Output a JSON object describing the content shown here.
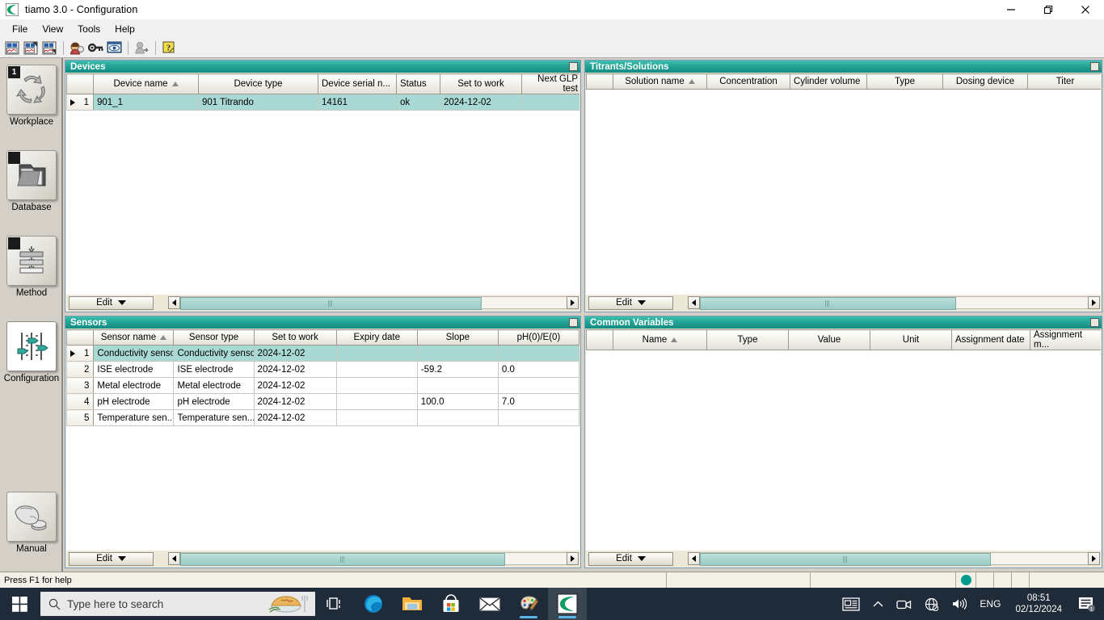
{
  "window": {
    "title": "tiamo 3.0 - Configuration",
    "app_icon": "tiamo-logo-icon",
    "controls": {
      "minimize": "—",
      "maximize": "❐",
      "close": "✕"
    }
  },
  "menubar": {
    "items": [
      "File",
      "View",
      "Tools",
      "Help"
    ]
  },
  "toolbar": {
    "buttons": [
      {
        "name": "new-configuration-icon"
      },
      {
        "name": "save-configuration-icon"
      },
      {
        "name": "save-as-configuration-icon"
      },
      {
        "name": "user-administration-icon"
      },
      {
        "name": "change-password-icon"
      },
      {
        "name": "login-icon"
      },
      {
        "name": "user-logout-icon"
      },
      {
        "name": "help-icon"
      }
    ]
  },
  "sidebar": {
    "items": [
      {
        "label": "Workplace",
        "badge": "1",
        "icon": "recycle-arrows-icon",
        "selected": false
      },
      {
        "label": "Database",
        "badge": "",
        "icon": "folder-icon",
        "selected": false
      },
      {
        "label": "Method",
        "badge": "",
        "icon": "method-stack-icon",
        "selected": false
      },
      {
        "label": "Configuration",
        "badge": "",
        "icon": "sliders-icon",
        "selected": true
      },
      {
        "label": "Manual",
        "badge": "",
        "icon": "hand-press-button-icon",
        "selected": false
      }
    ]
  },
  "panels": {
    "devices": {
      "title": "Devices",
      "columns": [
        "",
        "Device name",
        "Device type",
        "Device serial n...",
        "Status",
        "Set to work",
        "Next GLP test"
      ],
      "sorted_column": "Device name",
      "rows": [
        {
          "num": "1",
          "selected": true,
          "cells": [
            "901_1",
            "901 Titrando",
            "14161",
            "ok",
            "2024-12-02",
            ""
          ]
        }
      ],
      "edit_label": "Edit"
    },
    "titrants": {
      "title": "Titrants/Solutions",
      "columns": [
        "",
        "Solution name",
        "Concentration",
        "Cylinder volume",
        "Type",
        "Dosing device",
        "Titer"
      ],
      "sorted_column": "Solution name",
      "rows": [],
      "edit_label": "Edit"
    },
    "sensors": {
      "title": "Sensors",
      "columns": [
        "",
        "Sensor name",
        "Sensor type",
        "Set to work",
        "Expiry date",
        "Slope",
        "pH(0)/E(0)"
      ],
      "sorted_column": "Sensor name",
      "rows": [
        {
          "num": "1",
          "selected": true,
          "cells": [
            "Conductivity sensor",
            "Conductivity sensor",
            "2024-12-02",
            "",
            "",
            ""
          ]
        },
        {
          "num": "2",
          "selected": false,
          "cells": [
            "ISE electrode",
            "ISE electrode",
            "2024-12-02",
            "",
            "-59.2",
            "0.0"
          ]
        },
        {
          "num": "3",
          "selected": false,
          "cells": [
            "Metal electrode",
            "Metal electrode",
            "2024-12-02",
            "",
            "",
            ""
          ]
        },
        {
          "num": "4",
          "selected": false,
          "cells": [
            "pH electrode",
            "pH electrode",
            "2024-12-02",
            "",
            "100.0",
            "7.0"
          ]
        },
        {
          "num": "5",
          "selected": false,
          "cells": [
            "Temperature sen...",
            "Temperature sen...",
            "2024-12-02",
            "",
            "",
            ""
          ]
        }
      ],
      "edit_label": "Edit"
    },
    "common_variables": {
      "title": "Common Variables",
      "columns": [
        "",
        "Name",
        "Type",
        "Value",
        "Unit",
        "Assignment date",
        "Assignment m..."
      ],
      "sorted_column": "Name",
      "rows": [],
      "edit_label": "Edit"
    }
  },
  "statusbar": {
    "help_text": "Press F1 for help",
    "cell2": "",
    "cell3": "",
    "indicator_color": "#009a8e",
    "cell4": "",
    "cell5": "",
    "cell6": "",
    "cell7": ""
  },
  "taskbar": {
    "start": "windows-start-icon",
    "search_placeholder": "Type here to search",
    "search_icon": "search-icon",
    "widget_icon": "food-pie-icon",
    "taskview_icon": "task-view-icon",
    "apps": [
      {
        "name": "edge-icon",
        "running": false,
        "active": false
      },
      {
        "name": "file-explorer-icon",
        "running": false,
        "active": false
      },
      {
        "name": "microsoft-store-icon",
        "running": false,
        "active": false
      },
      {
        "name": "mail-icon",
        "running": false,
        "active": false
      },
      {
        "name": "paint-icon",
        "running": true,
        "active": false
      },
      {
        "name": "tiamo-icon",
        "running": true,
        "active": true
      }
    ],
    "tray": {
      "news_icon": "news-and-interests-icon",
      "chevron_icon": "show-hidden-icons-icon",
      "meet_icon": "meet-now-icon",
      "network_icon": "network-no-internet-icon",
      "volume_icon": "volume-icon",
      "language": "ENG",
      "time": "08:51",
      "date": "02/12/2024",
      "notification_icon": "notifications-icon",
      "notification_count": "1"
    }
  },
  "colors": {
    "panel_title_teal": "#1b9c8e",
    "selected_row": "#a9d9d4",
    "status_ok_green": "#0a8a0a",
    "taskbar_bg": "#1f2b38"
  }
}
